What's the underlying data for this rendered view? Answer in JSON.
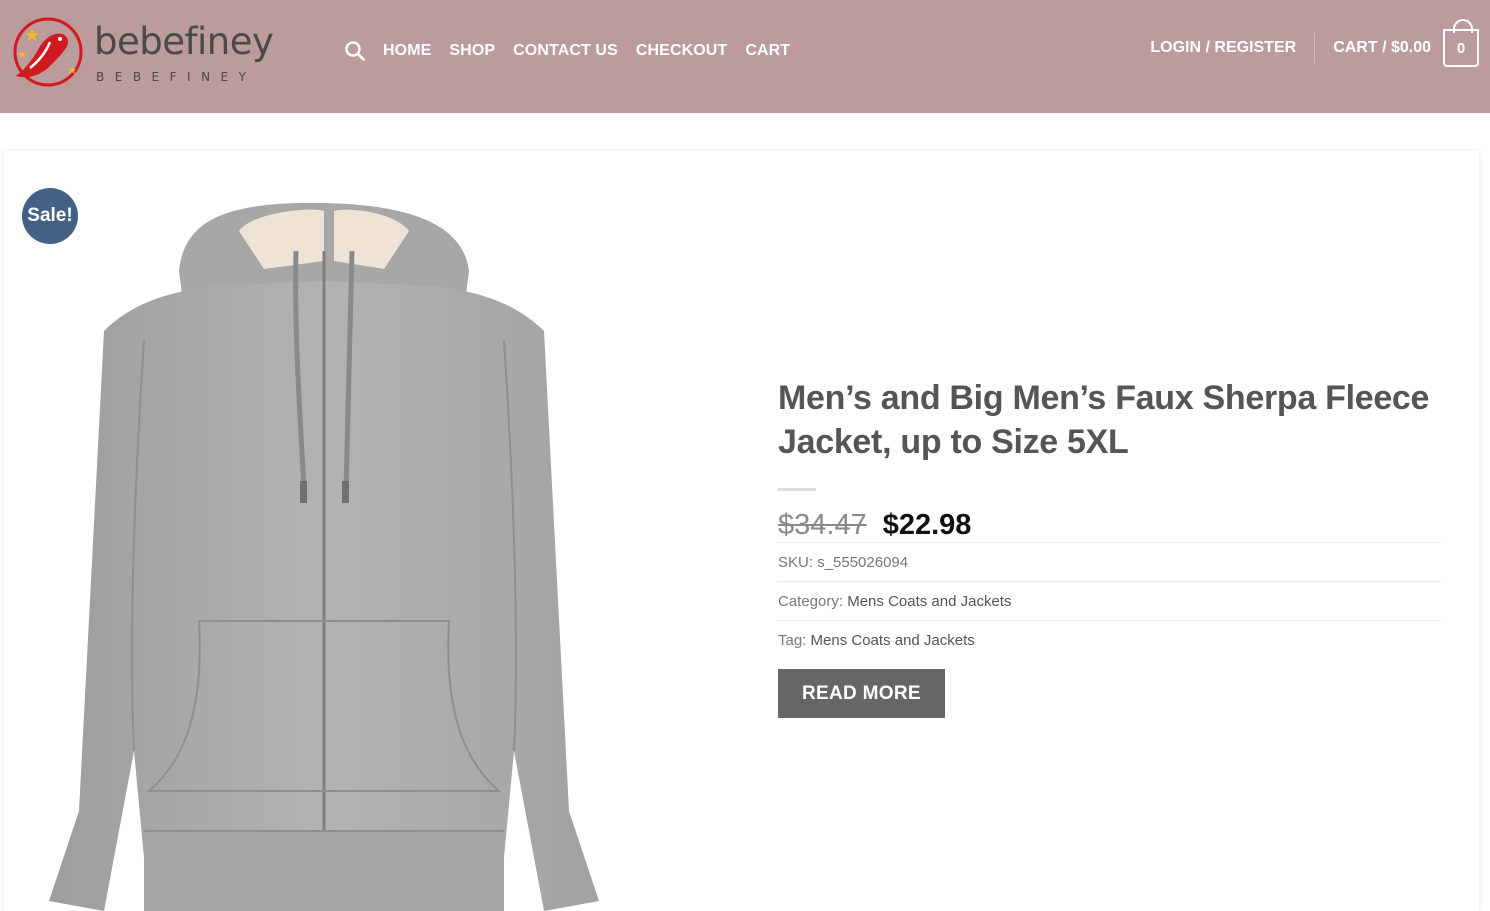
{
  "brand": {
    "name": "bebefiney",
    "tagline": "BEBEFINEY"
  },
  "nav": {
    "items": [
      {
        "label": "HOME"
      },
      {
        "label": "SHOP"
      },
      {
        "label": "CONTACT US"
      },
      {
        "label": "CHECKOUT"
      },
      {
        "label": "CART"
      }
    ],
    "search_icon": "search-icon"
  },
  "account": {
    "login_label": "LOGIN / REGISTER"
  },
  "cart": {
    "label": "CART / $0.00",
    "count": "0"
  },
  "product": {
    "badge": "Sale!",
    "title": "Men’s and Big Men’s Faux Sherpa Fleece Jacket, up to Size 5XL",
    "old_price": "$34.47",
    "new_price": "$22.98",
    "sku_label": "SKU:",
    "sku": "s_555026094",
    "category_label": "Category:",
    "category": "Mens Coats and Jackets",
    "tag_label": "Tag:",
    "tag": "Mens Coats and Jackets",
    "button_label": "READ MORE"
  },
  "colors": {
    "header_bg": "#bb9b9b",
    "badge_bg": "#446084",
    "button_bg": "#666666",
    "logo_red": "#d11a1f"
  }
}
